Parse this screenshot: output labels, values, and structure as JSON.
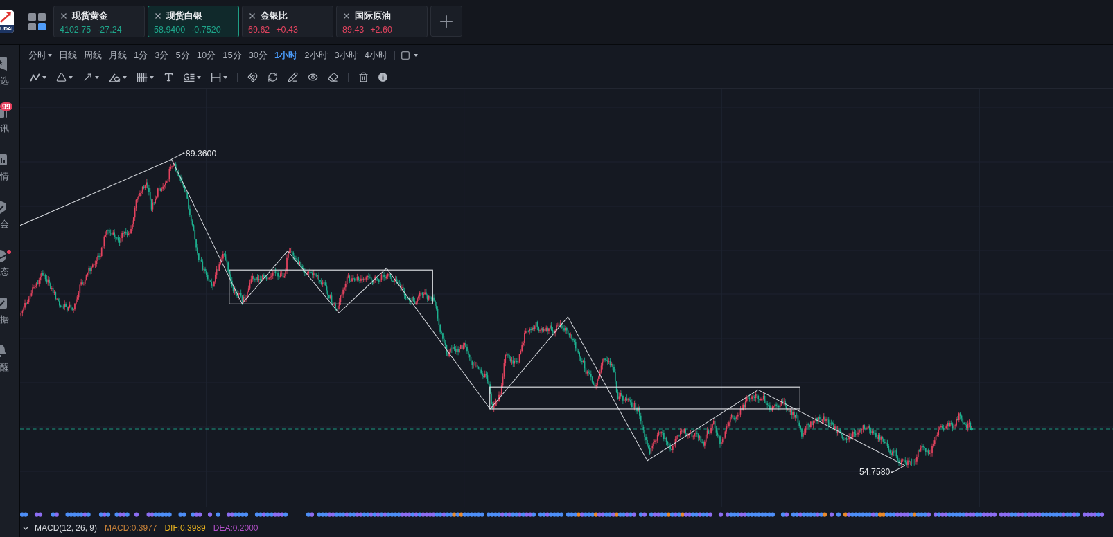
{
  "header": {
    "logo_text": "UDAI",
    "tabs": [
      {
        "name": "现货黄金",
        "price": "4102.75",
        "change": "-27.24",
        "color": "#1fa58a",
        "selected": false
      },
      {
        "name": "现货白银",
        "price": "58.9400",
        "change": "-0.7520",
        "color": "#1fa58a",
        "selected": true
      },
      {
        "name": "金银比",
        "price": "69.62",
        "change": "+0.43",
        "color": "#e2445f",
        "selected": false
      },
      {
        "name": "国际原油",
        "price": "89.43",
        "change": "+2.60",
        "color": "#e2445f",
        "selected": false
      }
    ]
  },
  "sidebar": {
    "items": [
      {
        "label": "选",
        "dot": false
      },
      {
        "label": "讯",
        "badge": "99",
        "dot": false
      },
      {
        "label": "情",
        "dot": false
      },
      {
        "label": "会",
        "dot": false
      },
      {
        "label": "态",
        "dot": true
      },
      {
        "label": "据",
        "dot": false
      },
      {
        "label": "醒",
        "dot": false
      }
    ]
  },
  "toolbar": {
    "timeframes": [
      {
        "label": "分时",
        "kind": "menu",
        "selected": false
      },
      {
        "label": "日线",
        "kind": "button",
        "selected": false
      },
      {
        "label": "周线",
        "kind": "button",
        "selected": false
      },
      {
        "label": "月线",
        "kind": "button",
        "selected": false
      },
      {
        "label": "1分",
        "kind": "button",
        "selected": false
      },
      {
        "label": "3分",
        "kind": "button",
        "selected": false
      },
      {
        "label": "5分",
        "kind": "button",
        "selected": false
      },
      {
        "label": "10分",
        "kind": "button",
        "selected": false
      },
      {
        "label": "15分",
        "kind": "button",
        "selected": false
      },
      {
        "label": "30分",
        "kind": "button",
        "selected": false
      },
      {
        "label": "1小时",
        "kind": "button",
        "selected": true
      },
      {
        "label": "2小时",
        "kind": "button",
        "selected": false
      },
      {
        "label": "3小时",
        "kind": "button",
        "selected": false
      },
      {
        "label": "4小时",
        "kind": "button",
        "selected": false
      }
    ]
  },
  "chart": {
    "high_label": "89.3600",
    "low_label": "54.7580"
  },
  "indicator": {
    "name": "MACD(12, 26, 9)",
    "values": [
      {
        "text": "MACD:0.3977",
        "color": "#c68139"
      },
      {
        "text": "DIF:0.3989",
        "color": "#e6b11f"
      },
      {
        "text": "DEA:0.2000",
        "color": "#b250c8"
      }
    ]
  }
}
